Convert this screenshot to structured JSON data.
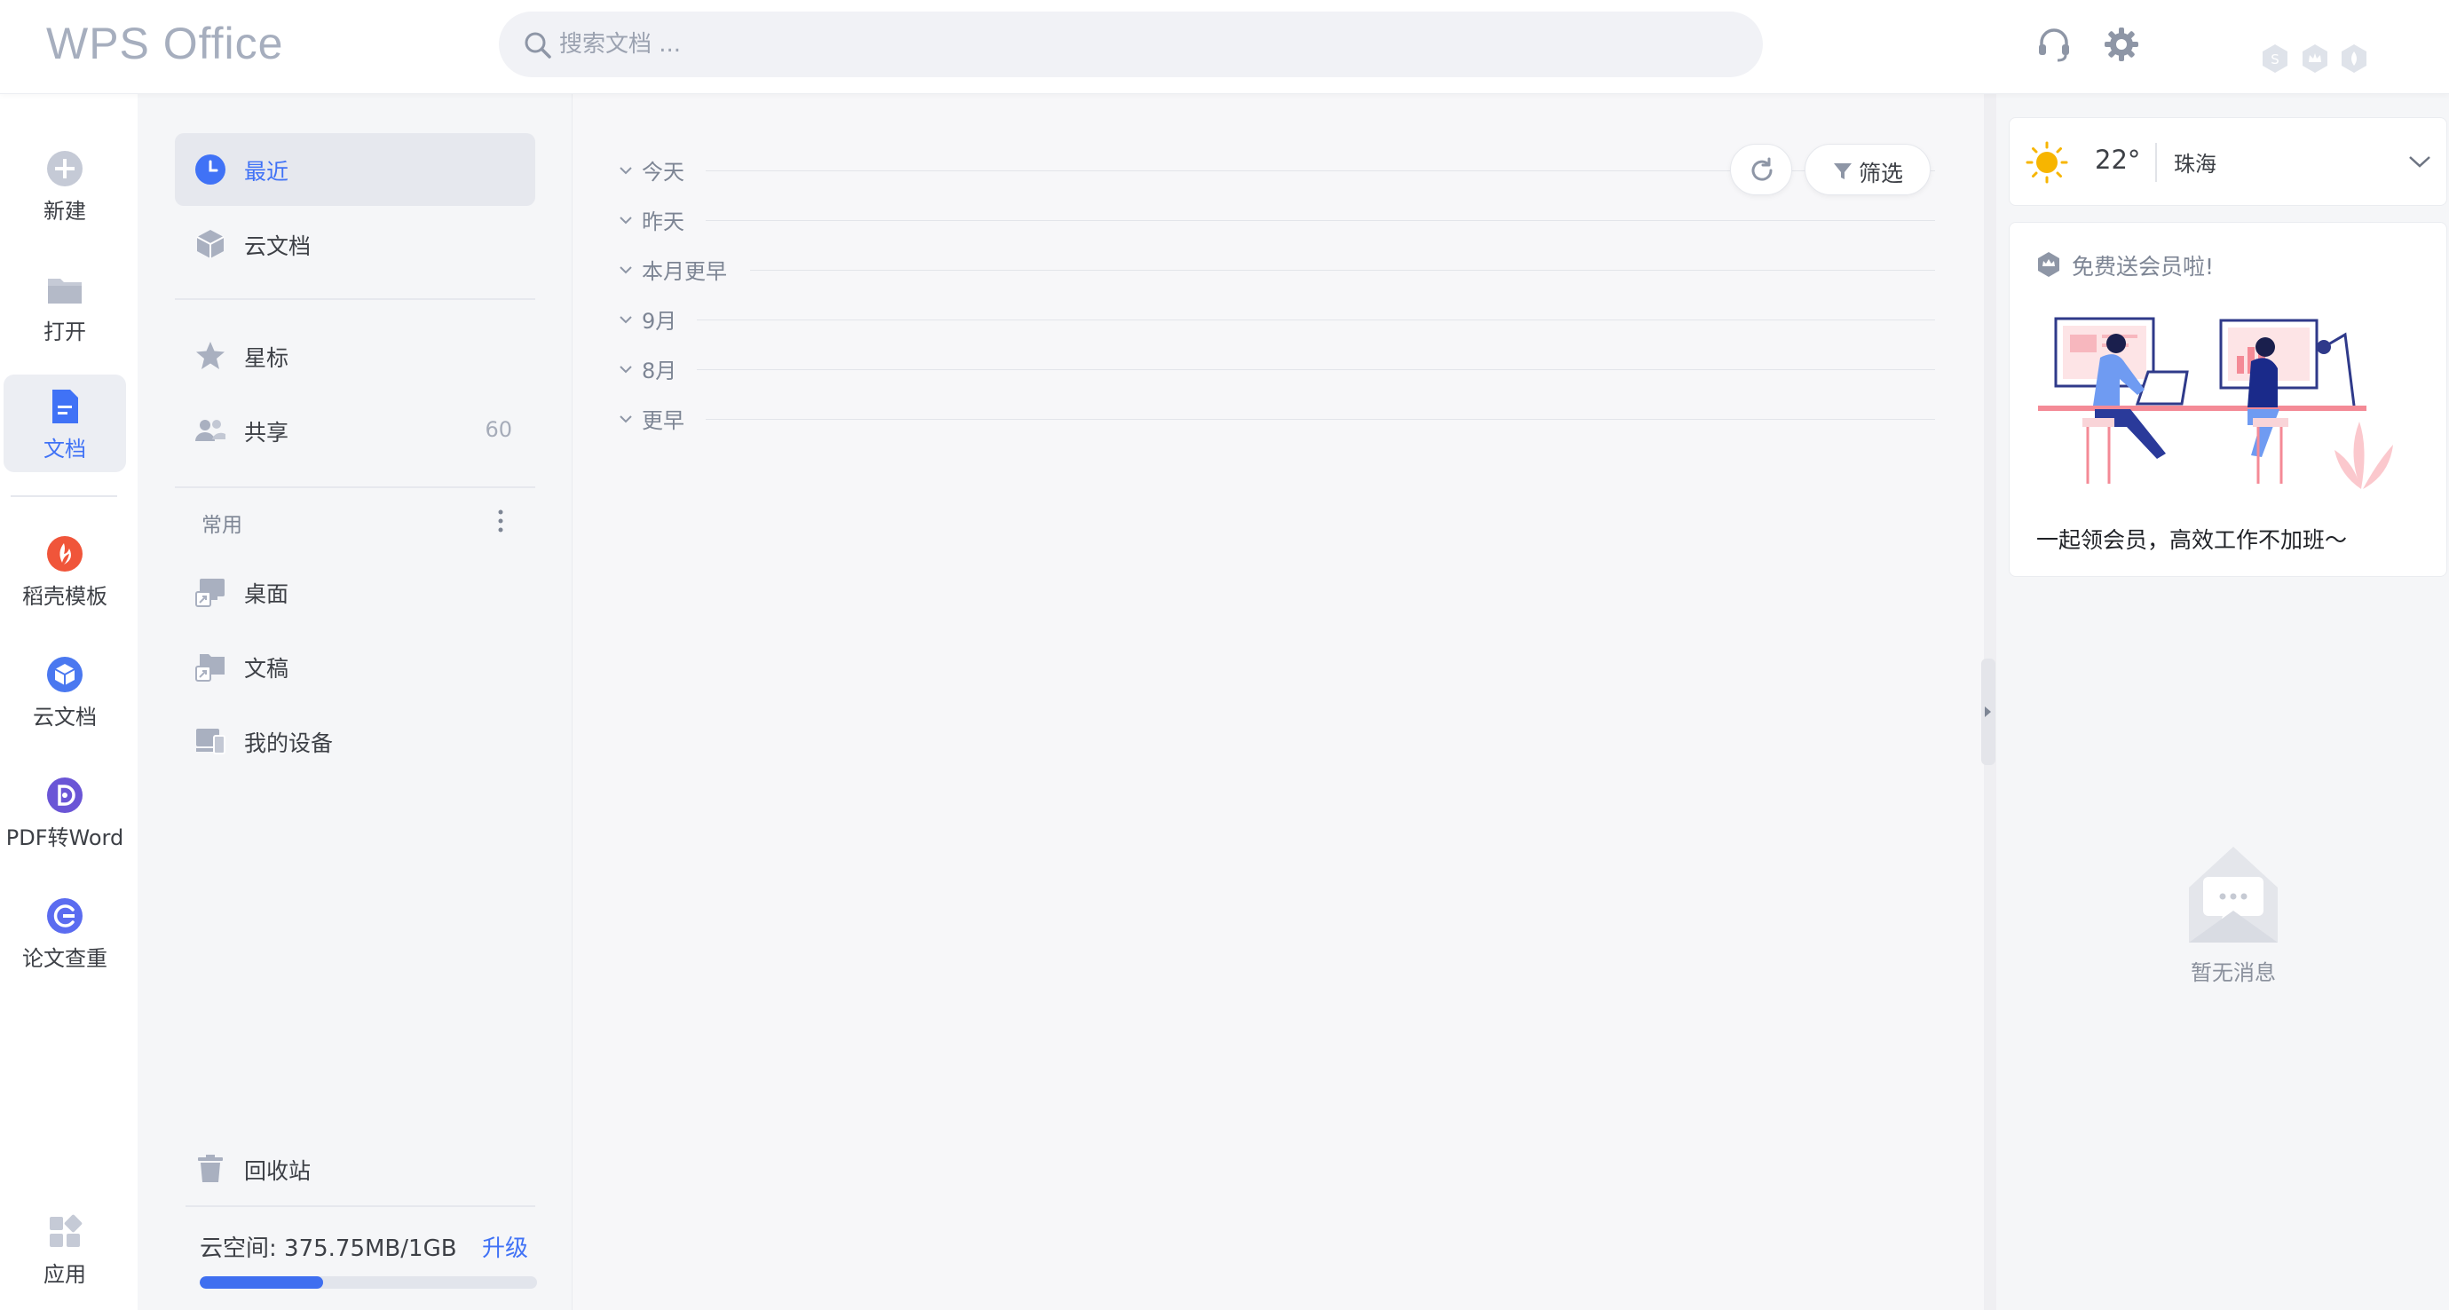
{
  "app": {
    "title": "WPS Office"
  },
  "search": {
    "placeholder": "搜索文档 ..."
  },
  "leftnav": {
    "items": [
      {
        "label": "新建",
        "icon": "plus-circle-icon"
      },
      {
        "label": "打开",
        "icon": "folder-icon"
      },
      {
        "label": "文档",
        "icon": "document-icon",
        "active": true
      },
      {
        "label": "稻壳模板",
        "icon": "docer-icon"
      },
      {
        "label": "云文档",
        "icon": "cloud-box-icon"
      },
      {
        "label": "PDF转Word",
        "icon": "pdf-icon"
      },
      {
        "label": "论文查重",
        "icon": "paper-check-icon"
      },
      {
        "label": "应用",
        "icon": "apps-grid-icon"
      }
    ]
  },
  "sidebar": {
    "recent": "最近",
    "cloud_docs": "云文档",
    "starred": "星标",
    "shared": "共享",
    "shared_count": "60",
    "common_section": "常用",
    "desktop": "桌面",
    "drafts": "文稿",
    "my_devices": "我的设备",
    "recycle_bin": "回收站",
    "cloud_space": "云空间: 375.75MB/1GB",
    "upgrade": "升级",
    "cloud_space_used_fraction": 0.367
  },
  "main": {
    "groups": [
      "今天",
      "昨天",
      "本月更早",
      "9月",
      "8月",
      "更早"
    ],
    "filter_label": "筛选"
  },
  "right": {
    "temperature": "22°",
    "city": "珠海",
    "promo_title": "免费送会员啦!",
    "promo_desc": "一起领会员，高效工作不加班～",
    "no_messages": "暂无消息"
  },
  "colors": {
    "accent": "#4072f6",
    "docer_red": "#f0553a",
    "purple": "#6a55d6",
    "sun": "#f7b500"
  }
}
